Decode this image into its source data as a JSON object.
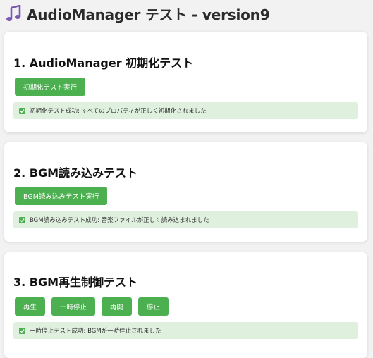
{
  "header": {
    "title": "AudioManager テスト - version9",
    "icon": "music-note-icon",
    "icon_color": "#7a5bb0"
  },
  "colors": {
    "button_bg": "#4caf50",
    "result_bg": "#dff0de",
    "check_bg": "#4caf50"
  },
  "sections": [
    {
      "title": "1. AudioManager 初期化テスト",
      "buttons": [
        "初期化テスト実行"
      ],
      "result": "初期化テスト成功: すべてのプロパティが正しく初期化されました"
    },
    {
      "title": "2. BGM読み込みテスト",
      "buttons": [
        "BGM読み込みテスト実行"
      ],
      "result": "BGM読み込みテスト成功: 音楽ファイルが正しく読み込まれました"
    },
    {
      "title": "3. BGM再生制御テスト",
      "buttons": [
        "再生",
        "一時停止",
        "再開",
        "停止"
      ],
      "result": "一時停止テスト成功: BGMが一時停止されました"
    }
  ]
}
